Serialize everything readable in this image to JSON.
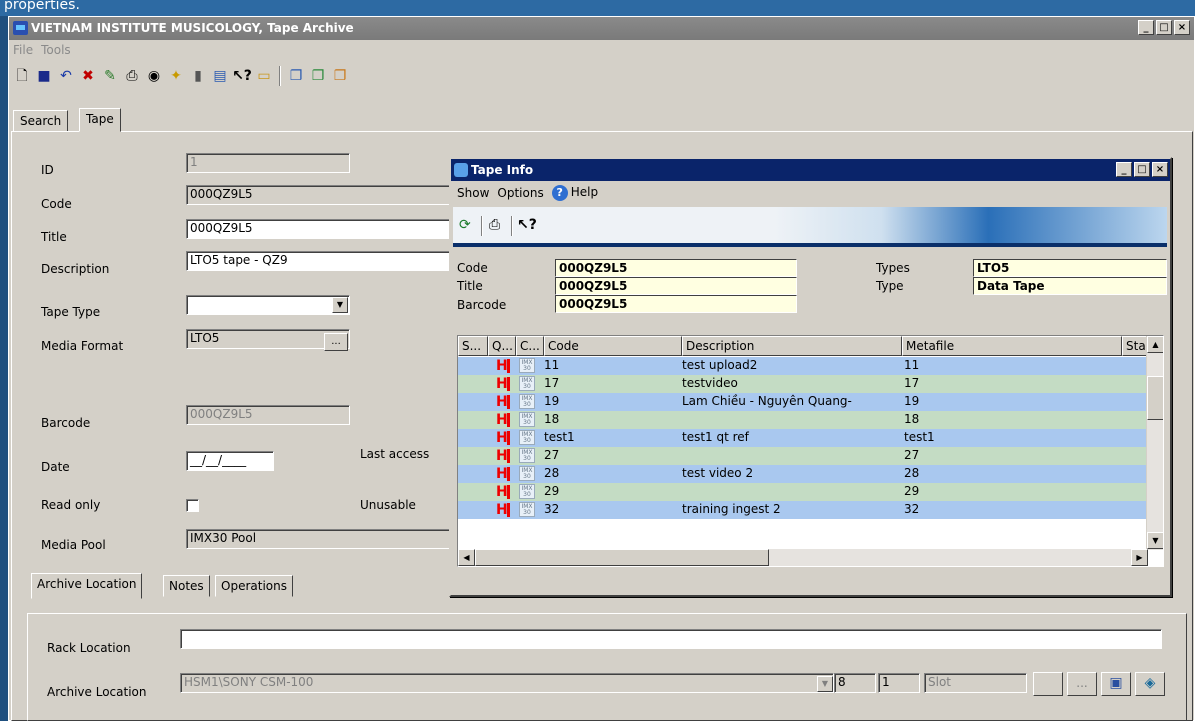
{
  "caption_strip": "properties.",
  "main_window": {
    "title": "VIETNAM INSTITUTE MUSICOLOGY, Tape Archive",
    "controls": {
      "minimize": "_",
      "maximize": "□",
      "close": "×"
    }
  },
  "menu": [
    "File",
    "Tools"
  ],
  "toolbar_icons": [
    "new-icon",
    "save-icon",
    "undo-icon",
    "delete-icon",
    "paint-icon",
    "print-icon",
    "archive-icon",
    "transfer-icon",
    "book-icon",
    "export-icon",
    "whats-this-icon",
    "folder-icon",
    "copy-a-icon",
    "copy-b-icon",
    "copy-c-icon"
  ],
  "tabs": {
    "search": "Search",
    "tape": "Tape"
  },
  "form": {
    "id_label": "ID",
    "id_value": "1",
    "code_label": "Code",
    "code_value": "000QZ9L5",
    "title_label": "Title",
    "title_value": "000QZ9L5",
    "description_label": "Description",
    "description_value": "LTO5 tape - QZ9",
    "tape_type_label": "Tape Type",
    "tape_type_value": "",
    "media_format_label": "Media Format",
    "media_format_value": "LTO5",
    "media_format_btn": "...",
    "barcode_label": "Barcode",
    "barcode_value": "000QZ9L5",
    "date_label": "Date",
    "date_value": "__/__/____",
    "last_access_label": "Last access",
    "read_only_label": "Read only",
    "unusable_label": "Unusable",
    "media_pool_label": "Media Pool",
    "media_pool_value": "IMX30 Pool"
  },
  "tape_info": {
    "title": "Tape Info",
    "menu": {
      "show": "Show",
      "options": "Options",
      "help": "Help",
      "help_icon_glyph": "?"
    },
    "toolbar": {
      "refresh": "refresh-icon",
      "print": "print-icon",
      "whats_this": "whats-this-icon"
    },
    "fields": {
      "code_label": "Code",
      "code_value": "000QZ9L5",
      "title_label": "Title",
      "title_value": "000QZ9L5",
      "barcode_label": "Barcode",
      "barcode_value": "000QZ9L5",
      "types_label": "Types",
      "types_value": "LTO5",
      "type_label": "Type",
      "type_value": "Data Tape"
    },
    "columns": [
      "S...",
      "Q...",
      "C...",
      "Code",
      "Description",
      "Metafile",
      "Sta"
    ],
    "status_mark": "H",
    "format_badge": "IMX 30",
    "rows": [
      {
        "code": "11",
        "description": "test upload2",
        "metafile": "11"
      },
      {
        "code": "17",
        "description": "testvideo",
        "metafile": "17"
      },
      {
        "code": "19",
        "description": "Lam Chiều - Nguyên Quang-",
        "metafile": "19"
      },
      {
        "code": "18",
        "description": "",
        "metafile": "18"
      },
      {
        "code": "test1",
        "description": "test1 qt ref",
        "metafile": "test1"
      },
      {
        "code": "27",
        "description": "",
        "metafile": "27"
      },
      {
        "code": "28",
        "description": "test video 2",
        "metafile": "28"
      },
      {
        "code": "29",
        "description": "",
        "metafile": "29"
      },
      {
        "code": "32",
        "description": "training ingest 2",
        "metafile": "32"
      }
    ]
  },
  "bottom_tabs": {
    "archive_location": "Archive Location",
    "notes": "Notes",
    "operations": "Operations"
  },
  "archive": {
    "rack_location_label": "Rack Location",
    "rack_location_value": "",
    "archive_location_label": "Archive Location",
    "archive_location_value": "HSM1\\SONY CSM-100",
    "num1": "8",
    "num2": "1",
    "slot": "Slot",
    "dots_btn": "..."
  }
}
